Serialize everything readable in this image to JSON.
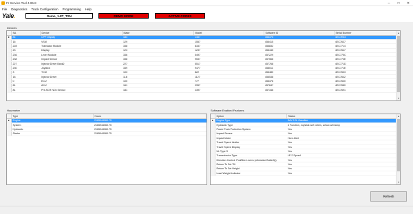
{
  "window": {
    "title": "Fr Service Tool 4.95.8"
  },
  "menu": {
    "items": [
      "File",
      "Diagnostics",
      "Truck Configuration",
      "Programming",
      "Help"
    ]
  },
  "header": {
    "logo_text": "Yale",
    "vehicle": "Demo_1-8T_TSN",
    "demo_mode": "DEMO MODE",
    "active_codes": "ACTIVE CODES"
  },
  "devices": {
    "label": "Devices",
    "columns": [
      "SA",
      "Device",
      "Make",
      "Model",
      "Software ID",
      "Serial Number"
    ],
    "rows": [
      [
        "84",
        "CPP Display",
        "184",
        "1457",
        "456375",
        "4EC7E64"
      ],
      [
        "16",
        "VSM",
        "129",
        "1557",
        "456415",
        "4EC7637"
      ],
      [
        "228",
        "Translator Module",
        "338",
        "8337",
        "456832",
        "4EC7714"
      ],
      [
        "23",
        "Display",
        "123",
        "1237",
        "456445",
        "4EC7647"
      ],
      [
        "236",
        "Lever Module",
        "336",
        "5497",
        "457229",
        "4EC775C"
      ],
      [
        "238",
        "Impact Sensor",
        "338",
        "9537",
        "457566",
        "4EC773E"
      ],
      [
        "227",
        "Injector Driver Bank2",
        "227",
        "5517",
        "457768",
        "4EC771D"
      ],
      [
        "230",
        "Joystick",
        "339",
        "9477",
        "458011",
        "4EC771E"
      ],
      [
        "3",
        "TCM",
        "103",
        "822",
        "456480",
        "4EC7633"
      ],
      [
        "18",
        "Injector Driver",
        "118",
        "1127",
        "456538",
        "4EC7642"
      ],
      [
        "0",
        "ECU",
        "100",
        "777",
        "456376",
        "4EC7630"
      ],
      [
        "61",
        "ACU",
        "161",
        "2957",
        "457647",
        "4EC7680"
      ],
      [
        "81",
        "Pre-SCR NOx Sensor",
        "181",
        "2397",
        "457346",
        "4EC7691"
      ]
    ]
  },
  "hourmeter": {
    "label": "Hourmeter",
    "columns": [
      "Type",
      "Hours"
    ],
    "rows": [
      [
        "Engine",
        "2165944060.75"
      ],
      [
        "System",
        "2165944060.75"
      ],
      [
        "Hydraulic",
        "2165944060.75"
      ],
      [
        "Starter",
        "2165944060.75"
      ]
    ]
  },
  "features": {
    "label": "Software Enabled Features",
    "columns": [
      "Option",
      "Status"
    ],
    "rows": [
      [
        "Engine Type",
        "IMV 2.0L Gasoline"
      ],
      [
        "Hydraulic Type",
        "4 Function, Joystick w/2 rollers, w/Aux w/Clamp"
      ],
      [
        "Power Train Protection System",
        "Yes"
      ],
      [
        "Impact Sensor",
        "Yes"
      ],
      [
        "Impact Mode",
        "Horn Alert"
      ],
      [
        "Travel Speed Limiter",
        "Yes"
      ],
      [
        "Travel Speed Display",
        "Yes"
      ],
      [
        "UL Type S",
        "Yes"
      ],
      [
        "Transmission Type",
        "LE 2 Speed"
      ],
      [
        "Direction Control: Pod/Bric Levers (otherwise Butterfly)",
        "Yes"
      ],
      [
        "Return To Set Tilt",
        "Yes"
      ],
      [
        "Return To Set Height",
        "Yes"
      ],
      [
        "Load Weight Indicator",
        "Yes"
      ]
    ]
  },
  "buttons": {
    "refresh": "Refresh"
  },
  "colors": {
    "selection": "#3399ff",
    "alert": "#e00000",
    "brand": "#f2a900"
  },
  "icons": {
    "minimize": "minimize-icon",
    "maximize": "maximize-icon",
    "close": "close-icon"
  }
}
